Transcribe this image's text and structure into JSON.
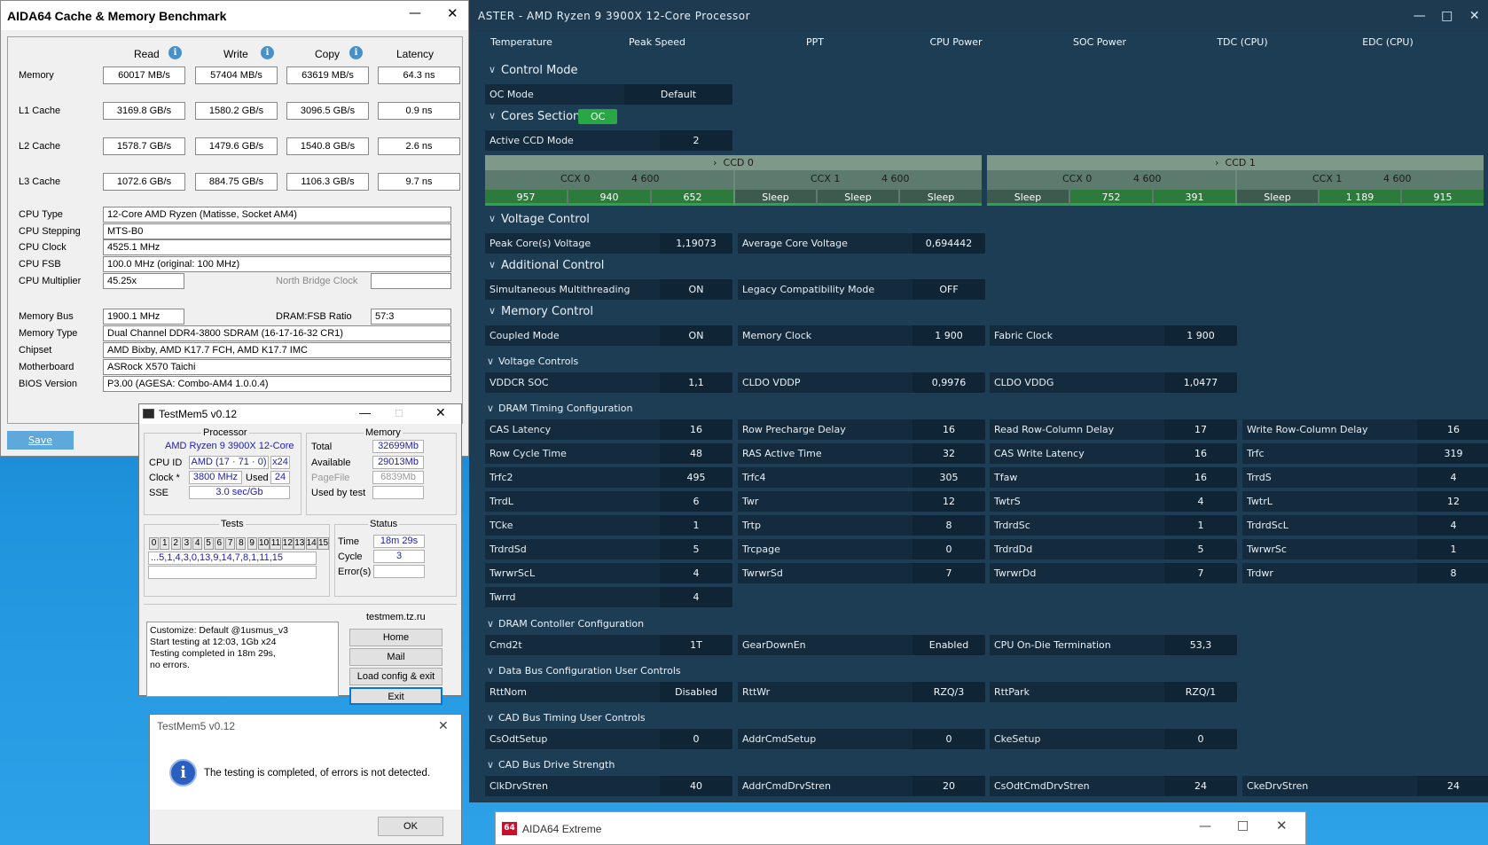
{
  "ryzen_master": {
    "title": "ASTER  -  AMD Ryzen 9 3900X 12-Core Processor",
    "tabs": [
      "Temperature",
      "Peak Speed",
      "PPT",
      "CPU Power",
      "SOC Power",
      "TDC (CPU)",
      "EDC (CPU)"
    ],
    "control_mode": {
      "heading": "Control Mode",
      "oc_mode_label": "OC Mode",
      "oc_mode_value": "Default"
    },
    "cores_section": {
      "heading": "Cores Section",
      "badge": "OC",
      "active_ccd_label": "Active CCD Mode",
      "active_ccd_value": "2"
    },
    "ccds": [
      {
        "label": "CCD 0",
        "ccx": [
          {
            "name": "CCX 0",
            "freq": "4 600",
            "cores": [
              "957",
              "940",
              "652"
            ]
          },
          {
            "name": "CCX 1",
            "freq": "4 600",
            "cores": [
              "Sleep",
              "Sleep",
              "Sleep"
            ]
          }
        ]
      },
      {
        "label": "CCD 1",
        "ccx": [
          {
            "name": "CCX 0",
            "freq": "4 600",
            "cores": [
              "Sleep",
              "752",
              "391"
            ]
          },
          {
            "name": "CCX 1",
            "freq": "4 600",
            "cores": [
              "Sleep",
              "1 189",
              "915"
            ]
          }
        ]
      }
    ],
    "voltage_control": {
      "heading": "Voltage Control",
      "peak_label": "Peak Core(s) Voltage",
      "peak_value": "1,19073",
      "avg_label": "Average Core Voltage",
      "avg_value": "0,694442"
    },
    "additional_control": {
      "heading": "Additional Control",
      "smt_label": "Simultaneous Multithreading",
      "smt_value": "ON",
      "legacy_label": "Legacy Compatibility Mode",
      "legacy_value": "OFF"
    },
    "memory_control": {
      "heading": "Memory Control",
      "coupled_label": "Coupled Mode",
      "coupled_value": "ON",
      "memclk_label": "Memory Clock",
      "memclk_value": "1 900",
      "fclk_label": "Fabric Clock",
      "fclk_value": "1 900"
    },
    "voltage_controls": {
      "heading": "Voltage Controls",
      "items": [
        [
          "VDDCR SOC",
          "1,1"
        ],
        [
          "CLDO VDDP",
          "0,9976"
        ],
        [
          "CLDO VDDG",
          "1,0477"
        ]
      ]
    },
    "dram_timing": {
      "heading": "DRAM Timing Configuration",
      "rows": [
        [
          [
            "CAS Latency",
            "16"
          ],
          [
            "Row Precharge Delay",
            "16"
          ],
          [
            "Read Row-Column Delay",
            "17"
          ],
          [
            "Write Row-Column Delay",
            "16"
          ]
        ],
        [
          [
            "Row Cycle Time",
            "48"
          ],
          [
            "RAS Active Time",
            "32"
          ],
          [
            "CAS Write Latency",
            "16"
          ],
          [
            "Trfc",
            "319"
          ]
        ],
        [
          [
            "Trfc2",
            "495"
          ],
          [
            "Trfc4",
            "305"
          ],
          [
            "Tfaw",
            "16"
          ],
          [
            "TrrdS",
            "4"
          ]
        ],
        [
          [
            "TrrdL",
            "6"
          ],
          [
            "Twr",
            "12"
          ],
          [
            "TwtrS",
            "4"
          ],
          [
            "TwtrL",
            "12"
          ]
        ],
        [
          [
            "TCke",
            "1"
          ],
          [
            "Trtp",
            "8"
          ],
          [
            "TrdrdSc",
            "1"
          ],
          [
            "TrdrdScL",
            "4"
          ]
        ],
        [
          [
            "TrdrdSd",
            "5"
          ],
          [
            "Trcpage",
            "0"
          ],
          [
            "TrdrdDd",
            "5"
          ],
          [
            "TwrwrSc",
            "1"
          ]
        ],
        [
          [
            "TwrwrScL",
            "4"
          ],
          [
            "TwrwrSd",
            "7"
          ],
          [
            "TwrwrDd",
            "7"
          ],
          [
            "Trdwr",
            "8"
          ]
        ],
        [
          [
            "Twrrd",
            "4"
          ]
        ]
      ]
    },
    "dram_controller": {
      "heading": "DRAM Contoller Configuration",
      "items": [
        [
          "Cmd2t",
          "1T"
        ],
        [
          "GearDownEn",
          "Enabled"
        ],
        [
          "CPU On-Die Termination",
          "53,3"
        ]
      ]
    },
    "data_bus": {
      "heading": "Data Bus Configuration User Controls",
      "items": [
        [
          "RttNom",
          "Disabled"
        ],
        [
          "RttWr",
          "RZQ/3"
        ],
        [
          "RttPark",
          "RZQ/1"
        ]
      ]
    },
    "cad_timing": {
      "heading": "CAD Bus Timing User Controls",
      "items": [
        [
          "CsOdtSetup",
          "0"
        ],
        [
          "AddrCmdSetup",
          "0"
        ],
        [
          "CkeSetup",
          "0"
        ]
      ]
    },
    "cad_drive": {
      "heading": "CAD Bus Drive Strength",
      "items": [
        [
          "ClkDrvStren",
          "40"
        ],
        [
          "AddrCmdDrvStren",
          "20"
        ],
        [
          "CsOdtCmdDrvStren",
          "24"
        ],
        [
          "CkeDrvStren",
          "24"
        ]
      ]
    },
    "colors": {
      "bg": "#1d3d55",
      "field": "#0f2536",
      "oc_badge": "#28a745"
    }
  },
  "aida": {
    "title": "AIDA64 Cache & Memory Benchmark",
    "headers": [
      "Read",
      "Write",
      "Copy",
      "Latency"
    ],
    "rows": [
      {
        "label": "Memory",
        "vals": [
          "60017 MB/s",
          "57404 MB/s",
          "63619 MB/s",
          "64.3 ns"
        ]
      },
      {
        "label": "L1 Cache",
        "vals": [
          "3169.8 GB/s",
          "1580.2 GB/s",
          "3096.5 GB/s",
          "0.9 ns"
        ]
      },
      {
        "label": "L2 Cache",
        "vals": [
          "1578.7 GB/s",
          "1479.6 GB/s",
          "1540.8 GB/s",
          "2.6 ns"
        ]
      },
      {
        "label": "L3 Cache",
        "vals": [
          "1072.6 GB/s",
          "884.75 GB/s",
          "1106.3 GB/s",
          "9.7 ns"
        ]
      }
    ],
    "info": {
      "cpu_type_label": "CPU Type",
      "cpu_type": "12-Core AMD Ryzen  (Matisse, Socket AM4)",
      "stepping_label": "CPU Stepping",
      "stepping": "MTS-B0",
      "clock_label": "CPU Clock",
      "clock": "4525.1 MHz",
      "fsb_label": "CPU FSB",
      "fsb": "100.0 MHz  (original: 100 MHz)",
      "mult_label": "CPU Multiplier",
      "mult": "45.25x",
      "nb_label": "North Bridge Clock",
      "membus_label": "Memory Bus",
      "membus": "1900.1 MHz",
      "ratio_label": "DRAM:FSB Ratio",
      "ratio": "57:3",
      "memtype_label": "Memory Type",
      "memtype": "Dual Channel DDR4-3800 SDRAM  (16-17-16-32 CR1)",
      "chipset_label": "Chipset",
      "chipset": "AMD Bixby, AMD K17.7 FCH, AMD K17.7 IMC",
      "mobo_label": "Motherboard",
      "mobo": "ASRock X570 Taichi",
      "bios_label": "BIOS Version",
      "bios": "P3.00  (AGESA: Combo-AM4 1.0.0.4)"
    },
    "save": "Save"
  },
  "testmem": {
    "title": "TestMem5 v0.12",
    "processor_title": "Processor",
    "cpu_name": "AMD Ryzen 9 3900X 12-Core",
    "cpuid_label": "CPU ID",
    "cpuid": "AMD  (17 · 71 · 0)",
    "cpuid_threads": "x24",
    "clock_label": "Clock *",
    "clock": "3800 MHz",
    "used_label": "Used",
    "used": "24",
    "sse_label": "SSE",
    "sse": "3.0 sec/Gb",
    "memory_title": "Memory",
    "total_label": "Total",
    "total": "32699Mb",
    "avail_label": "Available",
    "avail": "29013Mb",
    "pagefile_label": "PageFile",
    "pagefile": "6839Mb",
    "usedby_label": "Used by test",
    "tests_title": "Tests",
    "test_ids": [
      "0",
      "1",
      "2",
      "3",
      "4",
      "5",
      "6",
      "7",
      "8",
      "9",
      "10",
      "11",
      "12",
      "13",
      "14",
      "15"
    ],
    "test_sequence": "...5,1,4,3,0,13,9,14,7,8,1,11,15",
    "status_title": "Status",
    "time_label": "Time",
    "time": "18m 29s",
    "cycle_label": "Cycle",
    "cycle": "3",
    "errors_label": "Error(s)",
    "site": "testmem.tz.ru",
    "log": [
      "Customize: Default @1usmus_v3",
      "Start testing at 12:03, 1Gb x24",
      "Testing completed in 18m 29s,",
      "no errors."
    ],
    "buttons": [
      "Home",
      "Mail",
      "Load config & exit",
      "Exit"
    ]
  },
  "dialog": {
    "title": "TestMem5 v0.12",
    "message": "The testing is completed, of errors is not detected.",
    "ok": "OK"
  },
  "aida_extreme": {
    "logo": "64",
    "title": "AIDA64 Extreme"
  }
}
